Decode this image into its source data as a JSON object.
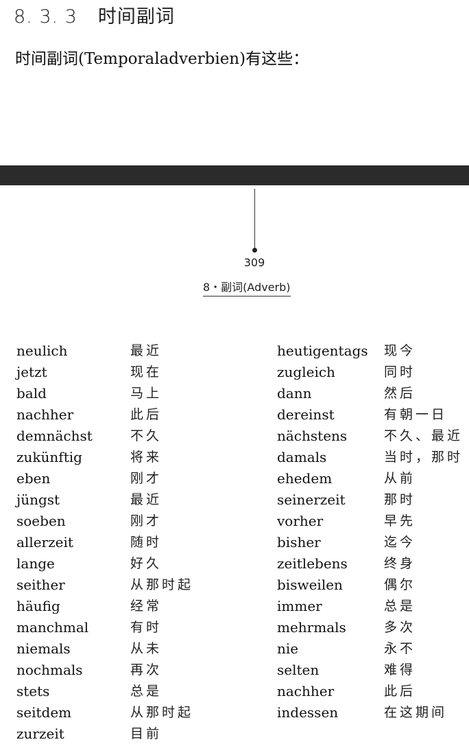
{
  "heading": {
    "number": "8. 3. 3",
    "title": "时间副词"
  },
  "intro": "时间副词(Temporaladverbien)有这些：",
  "page_number": "309",
  "running_head": "8・副词(Adverb)",
  "left_column": [
    {
      "de": "neulich",
      "zh": "最近"
    },
    {
      "de": "jetzt",
      "zh": "现在"
    },
    {
      "de": "bald",
      "zh": "马上"
    },
    {
      "de": "nachher",
      "zh": "此后"
    },
    {
      "de": "demnächst",
      "zh": "不久"
    },
    {
      "de": "zukünftig",
      "zh": "将来"
    },
    {
      "de": "eben",
      "zh": "刚才"
    },
    {
      "de": "jüngst",
      "zh": "最近"
    },
    {
      "de": "soeben",
      "zh": "刚才"
    },
    {
      "de": "allerzeit",
      "zh": "随时"
    },
    {
      "de": "lange",
      "zh": "好久"
    },
    {
      "de": "seither",
      "zh": "从那时起"
    },
    {
      "de": "häufig",
      "zh": "经常"
    },
    {
      "de": "manchmal",
      "zh": "有时"
    },
    {
      "de": "niemals",
      "zh": "从未"
    },
    {
      "de": "nochmals",
      "zh": "再次"
    },
    {
      "de": "stets",
      "zh": "总是"
    },
    {
      "de": "seitdem",
      "zh": "从那时起"
    },
    {
      "de": "zurzeit",
      "zh": "目前"
    }
  ],
  "right_column": [
    {
      "de": "heutigentags",
      "zh": "现今"
    },
    {
      "de": "zugleich",
      "zh": "同时"
    },
    {
      "de": "dann",
      "zh": "然后"
    },
    {
      "de": "dereinst",
      "zh": "有朝一日"
    },
    {
      "de": "nächstens",
      "zh": "不久、最近"
    },
    {
      "de": "damals",
      "zh": "当时，那时"
    },
    {
      "de": "ehedem",
      "zh": "从前"
    },
    {
      "de": "seinerzeit",
      "zh": "那时"
    },
    {
      "de": "vorher",
      "zh": "早先"
    },
    {
      "de": "bisher",
      "zh": "迄今"
    },
    {
      "de": "zeitlebens",
      "zh": "终身"
    },
    {
      "de": "bisweilen",
      "zh": "偶尔"
    },
    {
      "de": "immer",
      "zh": "总是"
    },
    {
      "de": "mehrmals",
      "zh": "多次"
    },
    {
      "de": "nie",
      "zh": "永不"
    },
    {
      "de": "selten",
      "zh": "难得"
    },
    {
      "de": "nachher",
      "zh": "此后"
    },
    {
      "de": "indessen",
      "zh": "在这期间"
    }
  ]
}
